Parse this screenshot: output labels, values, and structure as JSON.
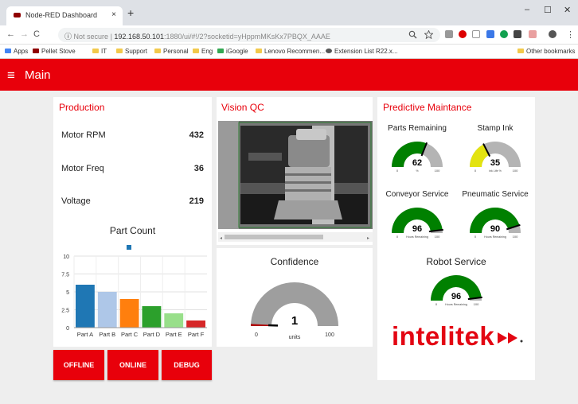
{
  "browser": {
    "tab_title": "Node-RED Dashboard",
    "tab_close": "×",
    "new_tab": "+",
    "security": "Not secure",
    "url_host": "192.168.50.101",
    "url_rest": ":1880/ui/#!/2?socketid=yHppmMKsKx7PBQX_AAAE",
    "bookmarks": [
      "Apps",
      "Pellet Stove",
      "IT",
      "Support",
      "Personal",
      "Eng",
      "iGoogle",
      "Lenovo Recommen...",
      "Extension List R22.x..."
    ],
    "other_bookmarks": "Other bookmarks",
    "win_min": "–",
    "win_max": "☐",
    "win_close": "✕",
    "nav_back": "←",
    "nav_forward": "→",
    "nav_reload": "C",
    "info_icon_glyph": "ⓘ"
  },
  "dashboard": {
    "menu_icon": "≡",
    "title": "Main"
  },
  "production": {
    "title": "Production",
    "rows": [
      {
        "label": "Motor RPM",
        "value": "432"
      },
      {
        "label": "Motor Freq",
        "value": "36"
      },
      {
        "label": "Voltage",
        "value": "219"
      }
    ],
    "chart_title": "Part Count",
    "buttons": [
      "OFFLINE",
      "ONLINE",
      "DEBUG"
    ]
  },
  "chart_data": {
    "type": "bar",
    "title": "Part Count",
    "categories": [
      "Part A",
      "Part B",
      "Part C",
      "Part D",
      "Part E",
      "Part F"
    ],
    "values": [
      6,
      5,
      4,
      3,
      2,
      1
    ],
    "colors": [
      "#1f77b4",
      "#aec7e8",
      "#ff7f0e",
      "#2ca02c",
      "#98df8a",
      "#d62728"
    ],
    "ylim": [
      0,
      10
    ],
    "yticks": [
      0,
      2.5,
      5,
      7.5,
      10
    ],
    "ytick_labels": [
      "0",
      "2.5",
      "5",
      "7.5",
      "10"
    ],
    "grid": true
  },
  "vision": {
    "title": "Vision QC",
    "confidence_title": "Confidence",
    "confidence_value": 1,
    "confidence_value_text": "1",
    "confidence_units": "units",
    "confidence_min": "0",
    "confidence_max": "100"
  },
  "maintenance": {
    "title": "Predictive Maintance",
    "gauges": [
      {
        "title": "Parts Remaining",
        "value": 62,
        "value_text": "62",
        "units": "%",
        "min": "0",
        "max": "100",
        "color": "#008000"
      },
      {
        "title": "Stamp Ink",
        "value": 35,
        "value_text": "35",
        "units": "ink Life %",
        "min": "0",
        "max": "100",
        "color": "#e3e310"
      },
      {
        "title": "Conveyor Service",
        "value": 96,
        "value_text": "96",
        "units": "Hours Remaining",
        "min": "0",
        "max": "100",
        "color": "#008000"
      },
      {
        "title": "Pneumatic Service",
        "value": 90,
        "value_text": "90",
        "units": "Hours Remaining",
        "min": "0",
        "max": "100",
        "color": "#008000"
      }
    ],
    "robot": {
      "title": "Robot Service",
      "value": 96,
      "value_text": "96",
      "units": "Hours Remaining",
      "min": "0",
      "max": "100",
      "color": "#008000"
    },
    "logo": "intelitek"
  }
}
